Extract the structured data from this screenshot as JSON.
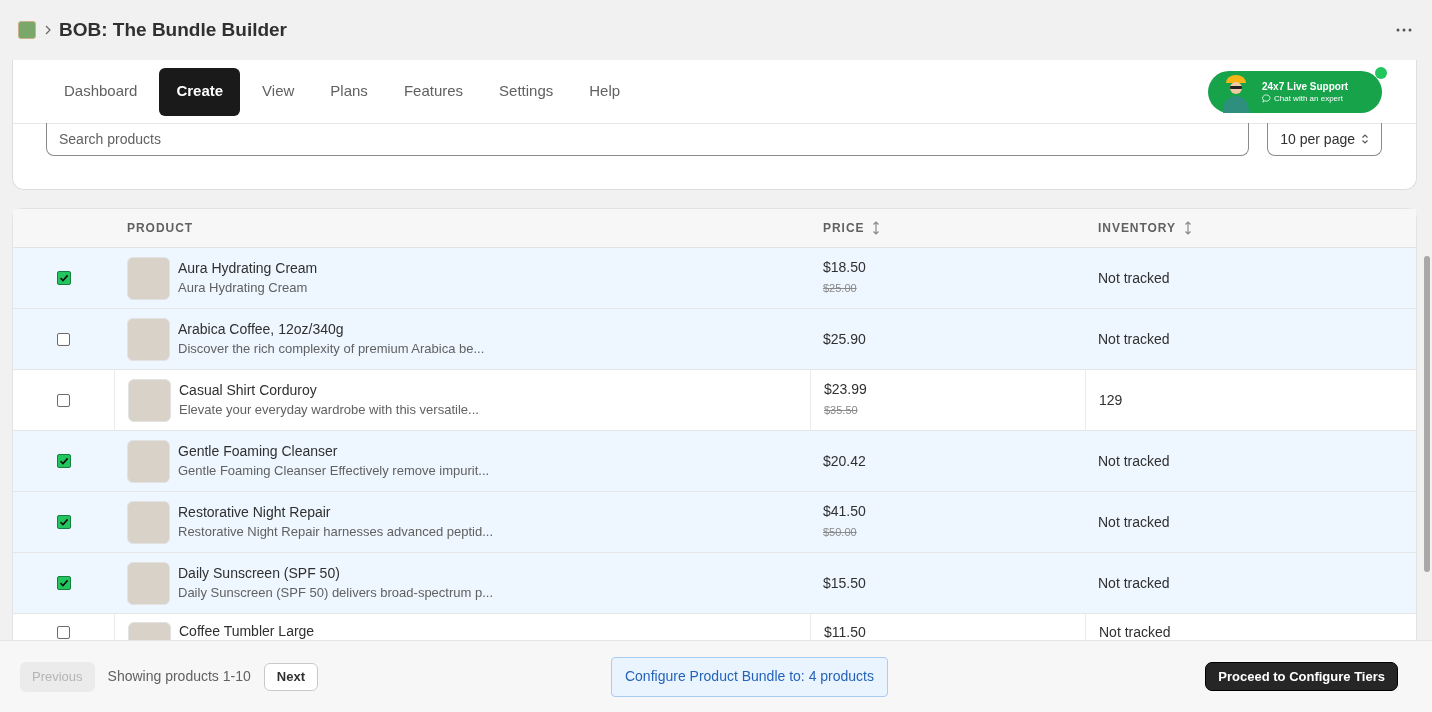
{
  "header": {
    "title": "BOB: The Bundle Builder"
  },
  "nav": {
    "tabs": [
      {
        "label": "Dashboard",
        "selected": false
      },
      {
        "label": "Create",
        "selected": true
      },
      {
        "label": "View",
        "selected": false
      },
      {
        "label": "Plans",
        "selected": false
      },
      {
        "label": "Features",
        "selected": false
      },
      {
        "label": "Settings",
        "selected": false
      },
      {
        "label": "Help",
        "selected": false
      }
    ],
    "support": {
      "title": "24x7 Live Support",
      "subtitle": "Chat with an expert",
      "online": true
    }
  },
  "search": {
    "placeholder": "Search products",
    "per_page": "10 per page"
  },
  "table": {
    "columns": [
      {
        "label": "PRODUCT",
        "sortable": false
      },
      {
        "label": "PRICE",
        "sortable": true
      },
      {
        "label": "INVENTORY",
        "sortable": true
      }
    ],
    "rows": [
      {
        "checked": true,
        "highlighted": true,
        "name": "Aura Hydrating Cream",
        "description": "Aura Hydrating Cream",
        "price": "$18.50",
        "compare_at": "$25.00",
        "inventory": "Not tracked"
      },
      {
        "checked": false,
        "highlighted": true,
        "name": "Arabica Coffee, 12oz/340g",
        "description": "Discover the rich complexity of premium Arabica be...",
        "price": "$25.90",
        "inventory": "Not tracked"
      },
      {
        "checked": false,
        "highlighted": false,
        "name": "Casual Shirt Corduroy",
        "description": "Elevate your everyday wardrobe with this versatile...",
        "price": "$23.99",
        "compare_at": "$35.50",
        "inventory": "129"
      },
      {
        "checked": true,
        "highlighted": true,
        "name": "Gentle Foaming Cleanser",
        "description": "Gentle Foaming Cleanser Effectively remove impurit...",
        "price": "$20.42",
        "inventory": "Not tracked"
      },
      {
        "checked": true,
        "highlighted": true,
        "name": "Restorative Night Repair",
        "description": "Restorative Night Repair harnesses advanced peptid...",
        "price": "$41.50",
        "compare_at": "$50.00",
        "inventory": "Not tracked"
      },
      {
        "checked": true,
        "highlighted": true,
        "name": "Daily Sunscreen (SPF 50)",
        "description": "Daily Sunscreen (SPF 50) delivers broad-spectrum p...",
        "price": "$15.50",
        "inventory": "Not tracked"
      },
      {
        "checked": false,
        "highlighted": false,
        "name": "Coffee Tumbler Large",
        "price": "$11.50",
        "inventory": "Not tracked"
      }
    ]
  },
  "footer": {
    "previous": {
      "label": "Previous",
      "disabled": true
    },
    "status": "Showing products 1-10",
    "next": {
      "label": "Next",
      "disabled": false
    },
    "bundle_info": "Configure Product Bundle to: 4 products",
    "proceed": "Proceed to Configure Tiers"
  }
}
